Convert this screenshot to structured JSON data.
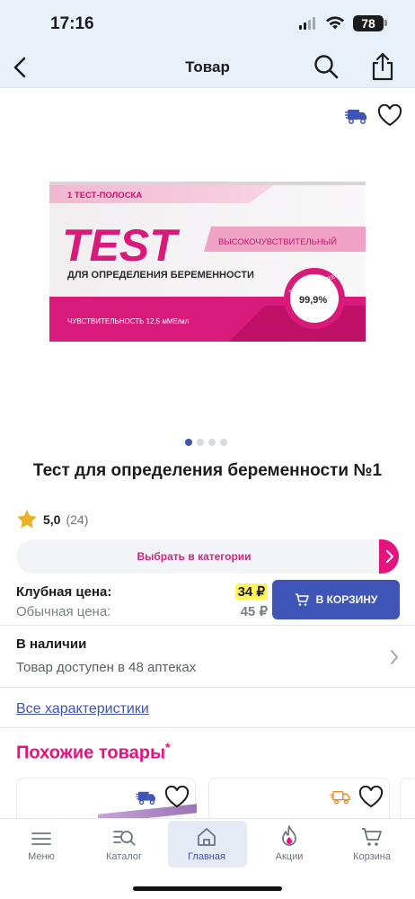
{
  "status_bar": {
    "time": "17:16",
    "battery": "78"
  },
  "nav": {
    "title": "Товар",
    "back_icon": "chevron-left-icon",
    "search_icon": "search-icon",
    "share_icon": "share-icon"
  },
  "product": {
    "image": {
      "strip_count": "1 ТЕСТ-ПОЛОСКА",
      "brand": "TEST",
      "sensitivity_badge": "ВЫСОКОЧУВСТВИТЕЛЬНЫЙ",
      "purpose": "ДЛЯ ОПРЕДЕЛЕНИЯ БЕРЕМЕННОСТИ",
      "accuracy_caption": "ТОЧНОСТЬ БОЛЕЕ",
      "accuracy_value": "99,9%",
      "sensitivity_text": "ЧУВСТВИТЕЛЬНОСТЬ 12,5 мМЕ/мл"
    },
    "gallery": {
      "count": 4,
      "active": 0
    },
    "title": "Тест для определения беременности №1",
    "rating": {
      "value": "5,0",
      "count": "(24)"
    },
    "select_category": "Выбрать в категории",
    "prices": {
      "club_label": "Клубная цена:",
      "club_price": "34 ₽",
      "regular_label": "Обычная цена:",
      "regular_price": "45 ₽"
    },
    "add_to_cart": "В КОРЗИНУ",
    "availability": {
      "heading": "В наличии",
      "subtext": "Товар доступен в 48 аптеках"
    },
    "all_specs_link": "Все характеристики"
  },
  "similar": {
    "heading": "Похожие товары",
    "marker": "*"
  },
  "tabbar": {
    "items": [
      {
        "label": "Меню",
        "icon": "menu-icon"
      },
      {
        "label": "Каталог",
        "icon": "catalog-search-icon"
      },
      {
        "label": "Главная",
        "icon": "home-icon"
      },
      {
        "label": "Акции",
        "icon": "flame-icon"
      },
      {
        "label": "Корзина",
        "icon": "cart-icon"
      }
    ],
    "active_index": 2
  },
  "colors": {
    "accent_blue": "#3e54b7",
    "brand_pink": "#e5137e",
    "price_highlight": "#fff25a",
    "header_bg": "#e8f1fa"
  }
}
